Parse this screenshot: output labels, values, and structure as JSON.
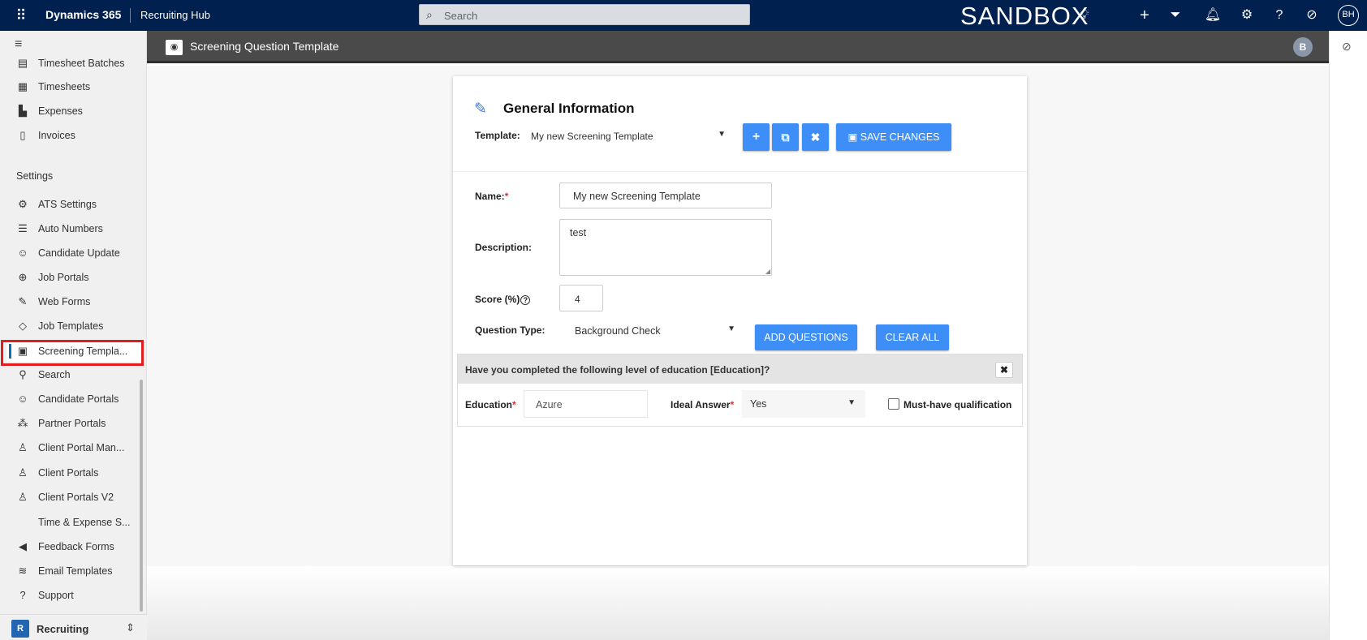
{
  "topbar": {
    "app_name": "Dynamics 365",
    "hub_name": "Recruiting Hub",
    "search_placeholder": "Search",
    "env_label": "SANDBOX",
    "user_initials": "BH"
  },
  "sidebar": {
    "items_top": [
      {
        "label": "Timesheet Batches",
        "icon": "batch-icon"
      },
      {
        "label": "Timesheets",
        "icon": "timesheet-icon"
      },
      {
        "label": "Expenses",
        "icon": "expense-icon"
      },
      {
        "label": "Invoices",
        "icon": "invoice-icon"
      }
    ],
    "section_settings": "Settings",
    "items_settings": [
      {
        "label": "ATS Settings",
        "icon": "gear-icon"
      },
      {
        "label": "Auto Numbers",
        "icon": "numbered-list-icon"
      },
      {
        "label": "Candidate Update",
        "icon": "people-icon"
      },
      {
        "label": "Job Portals",
        "icon": "globe-icon"
      },
      {
        "label": "Web Forms",
        "icon": "form-edit-icon"
      },
      {
        "label": "Job Templates",
        "icon": "tag-icon"
      },
      {
        "label": "Screening Templa...",
        "icon": "screening-icon",
        "selected": true
      },
      {
        "label": "Search",
        "icon": "binoculars-icon"
      },
      {
        "label": "Candidate Portals",
        "icon": "people-icon"
      },
      {
        "label": "Partner Portals",
        "icon": "group-icon"
      },
      {
        "label": "Client Portal Man...",
        "icon": "people-settings-icon"
      },
      {
        "label": "Client Portals",
        "icon": "person-key-icon"
      },
      {
        "label": "Client Portals V2",
        "icon": "person-key-icon"
      },
      {
        "label": "Time & Expense S...",
        "icon": ""
      },
      {
        "label": "Feedback Forms",
        "icon": "megaphone-icon"
      },
      {
        "label": "Email Templates",
        "icon": "layers-icon"
      },
      {
        "label": "Support",
        "icon": "help-circle-icon"
      }
    ],
    "area": {
      "badge": "R",
      "label": "Recruiting"
    }
  },
  "page_header": {
    "title": "Screening Question Template",
    "avatar": "B"
  },
  "form": {
    "heading": "General Information",
    "template_label": "Template:",
    "template_value": "My new Screening Template",
    "save_label": "SAVE CHANGES",
    "name_label": "Name:",
    "name_value": "My new Screening Template",
    "description_label": "Description:",
    "description_value": "test",
    "score_label": "Score (%)",
    "score_value": "4",
    "question_type_label": "Question Type:",
    "question_type_value": "Background Check",
    "add_questions_label": "ADD QUESTIONS",
    "clear_all_label": "CLEAR ALL"
  },
  "question": {
    "title": "Have you completed the following level of education [Education]?",
    "education_label": "Education",
    "education_value": "Azure",
    "ideal_answer_label": "Ideal Answer",
    "ideal_answer_value": "Yes",
    "must_have_label": "Must-have qualification",
    "must_have_checked": false
  },
  "colors": {
    "topbar": "#002050",
    "header": "#4a4a4a",
    "button": "#3e8ef7",
    "highlight": "#e11d1d"
  }
}
